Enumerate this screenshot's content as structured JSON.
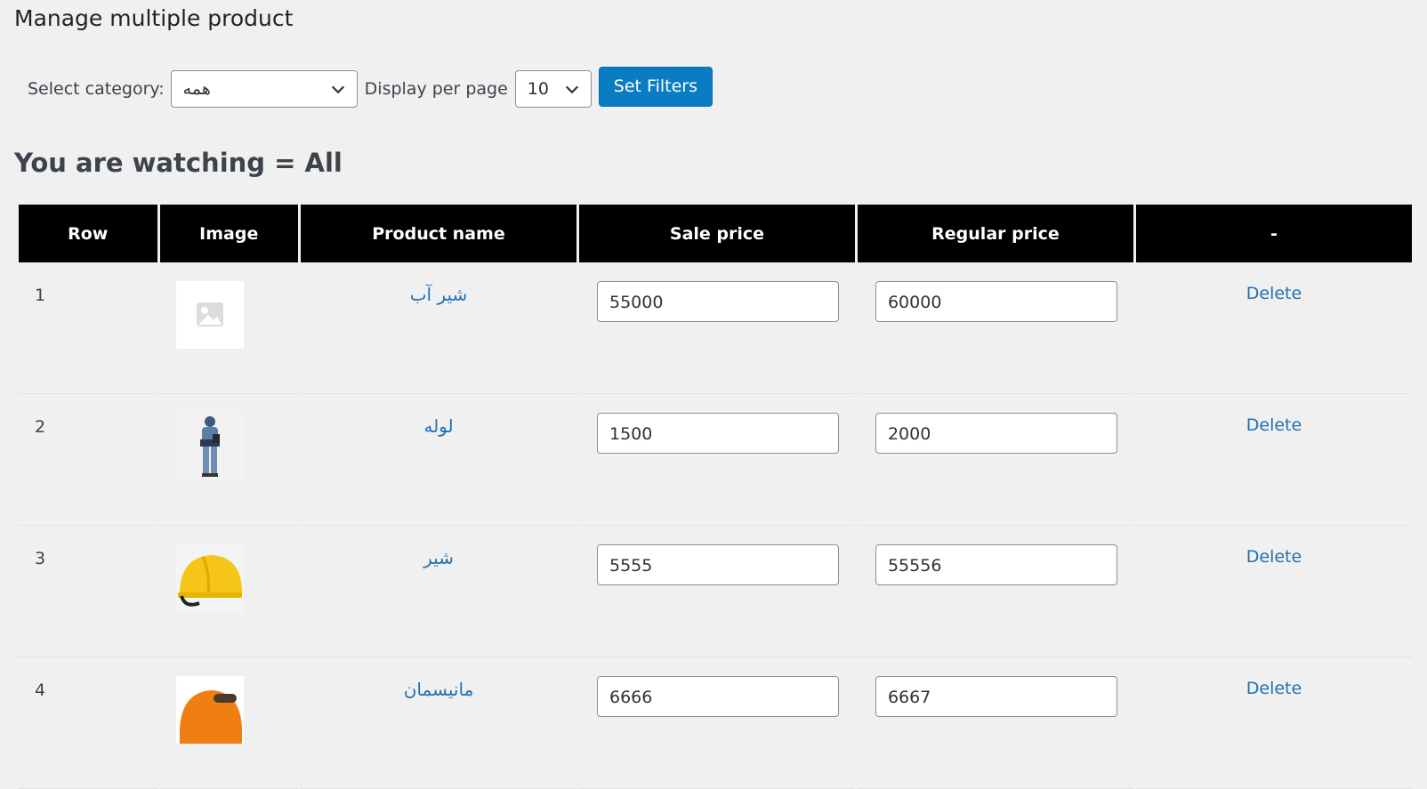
{
  "page": {
    "title": "Manage multiple product"
  },
  "filters": {
    "category_label": "Select category:",
    "category_value": "همه",
    "per_page_label": "Display per page",
    "per_page_value": "10",
    "submit_label": "Set Filters"
  },
  "watching": {
    "text": "You are watching = All"
  },
  "table": {
    "headers": [
      "Row",
      "Image",
      "Product name",
      "Sale price",
      "Regular price",
      "-"
    ],
    "rows": [
      {
        "row": "1",
        "image": "placeholder-image",
        "name": "شیر آب",
        "sale_price": "55000",
        "regular_price": "60000",
        "action": "Delete"
      },
      {
        "row": "2",
        "image": "worker-photo",
        "name": "لوله",
        "sale_price": "1500",
        "regular_price": "2000",
        "action": "Delete"
      },
      {
        "row": "3",
        "image": "yellow-helmet-photo",
        "name": "شیر",
        "sale_price": "5555",
        "regular_price": "55556",
        "action": "Delete"
      },
      {
        "row": "4",
        "image": "orange-helmet-photo",
        "name": "مانیسمان",
        "sale_price": "6666",
        "regular_price": "6667",
        "action": "Delete"
      }
    ]
  },
  "colors": {
    "accent": "#0a7cc1",
    "link": "#2271b1",
    "header_bg": "#000000",
    "page_bg": "#f0f0f1"
  }
}
